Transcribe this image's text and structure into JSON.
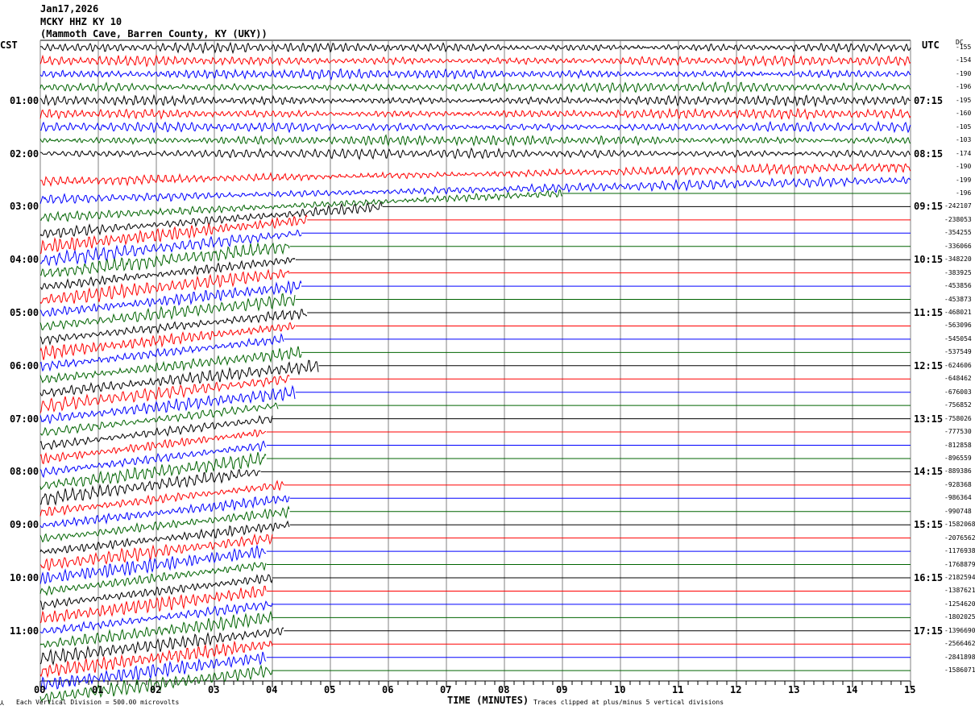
{
  "header": {
    "date": "Jan17,2026",
    "station": "MCKY HHZ KY 10",
    "location": "(Mammoth Cave, Barren County, KY (UKY))",
    "left_tz": "CST",
    "right_tz": "UTC",
    "dc_label": "DC"
  },
  "footer": {
    "scale_note": "Each Vertical Division =  500.00 microvolts",
    "xlabel": "TIME (MINUTES)",
    "clip_note": "Traces clipped at plus/minus 5 vertical divisions"
  },
  "chart_data": {
    "type": "line",
    "subtype": "helicorder",
    "xlabel": "TIME (MINUTES)",
    "xlim": [
      0,
      15
    ],
    "xticks": [
      "00",
      "01",
      "02",
      "03",
      "04",
      "05",
      "06",
      "07",
      "08",
      "09",
      "10",
      "11",
      "12",
      "13",
      "14",
      "15"
    ],
    "minor_tick_seconds": 10,
    "row_minutes": 15,
    "colors": [
      "#000000",
      "#ff0000",
      "#0000ff",
      "#006400"
    ],
    "grid": true,
    "left_labels": [
      "",
      "",
      "",
      "",
      "01:00",
      "",
      "",
      "",
      "02:00",
      "",
      "",
      "",
      "03:00",
      "",
      "",
      "",
      "04:00",
      "",
      "",
      "",
      "05:00",
      "",
      "",
      "",
      "06:00",
      "",
      "",
      "",
      "07:00",
      "",
      "",
      "",
      "08:00",
      "",
      "",
      "",
      "09:00",
      "",
      "",
      "",
      "10:00",
      "",
      "",
      "",
      "11:00",
      "",
      "",
      ""
    ],
    "right_labels": [
      "",
      "",
      "",
      "",
      "07:15",
      "",
      "",
      "",
      "08:15",
      "",
      "",
      "",
      "09:15",
      "",
      "",
      "",
      "10:15",
      "",
      "",
      "",
      "11:15",
      "",
      "",
      "",
      "12:15",
      "",
      "",
      "",
      "13:15",
      "",
      "",
      "",
      "14:15",
      "",
      "",
      "",
      "15:15",
      "",
      "",
      "",
      "16:15",
      "",
      "",
      "",
      "17:15",
      "",
      "",
      ""
    ],
    "dc_offsets": [
      "-155",
      "-154",
      "-190",
      "-196",
      "-195",
      "-160",
      "-105",
      "-103",
      "-174",
      "-190",
      "-199",
      "-196",
      "-242107",
      "-238053",
      "-354255",
      "-336066",
      "-348220",
      "-383925",
      "-453856",
      "-453873",
      "-468021",
      "-563096",
      "-545054",
      "-537549",
      "-624606",
      "-648462",
      "-676003",
      "-756852",
      "-758026",
      "-777530",
      "-812858",
      "-896559",
      "-889386",
      "-928368",
      "-986364",
      "-990748",
      "-1582068",
      "-2076562",
      "-1176938",
      "-1768879",
      "-2182594",
      "-1387621",
      "-1254620",
      "-1802025",
      "-1396690",
      "-2566462",
      "-2841898",
      "-1586071"
    ],
    "trace_end_minutes": [
      15,
      15,
      15,
      15,
      15,
      15,
      15,
      15,
      15,
      15,
      15,
      9,
      5.9,
      4.6,
      4.5,
      4.3,
      4.4,
      4.3,
      4.5,
      4.4,
      4.6,
      4.4,
      4.2,
      4.5,
      4.8,
      4.3,
      4.4,
      4.1,
      4.0,
      3.9,
      3.9,
      3.9,
      3.8,
      4.2,
      4.3,
      4.3,
      4.3,
      4.0,
      3.9,
      3.9,
      4.0,
      3.9,
      4.0,
      4.0,
      4.2,
      4.0,
      3.9,
      4.0
    ],
    "drift_start_row": 9
  }
}
